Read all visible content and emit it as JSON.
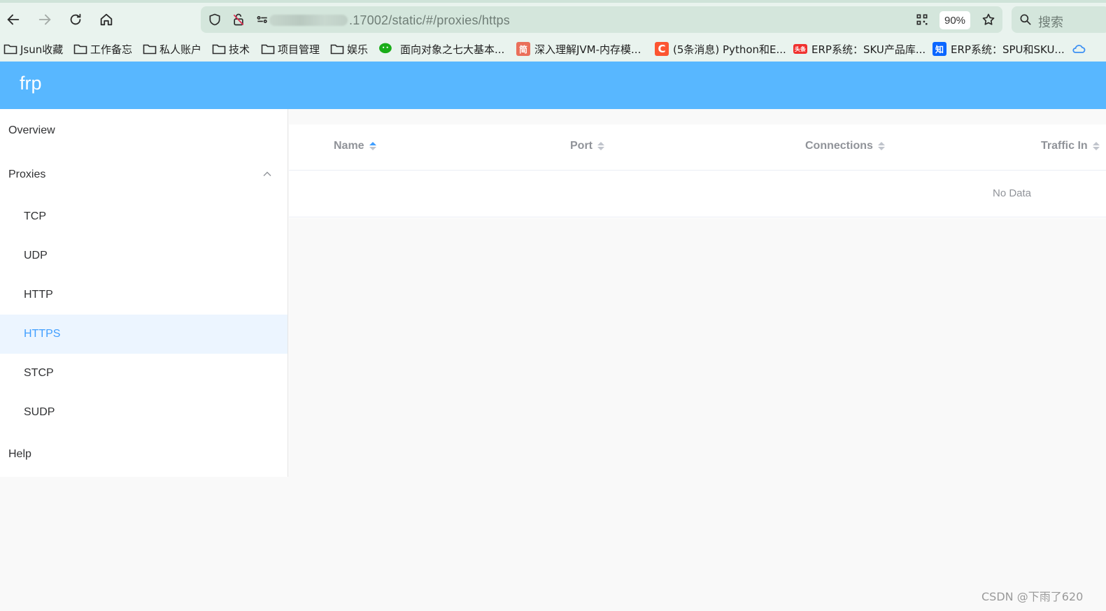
{
  "browser": {
    "url": ".17002/static/#/proxies/https",
    "zoom": "90%",
    "search_placeholder": "搜索",
    "bookmarks": [
      {
        "label": "Jsun收藏",
        "icon": "folder-icon"
      },
      {
        "label": "工作备忘",
        "icon": "folder-icon"
      },
      {
        "label": "私人账户",
        "icon": "folder-icon"
      },
      {
        "label": "技术",
        "icon": "folder-icon"
      },
      {
        "label": "项目管理",
        "icon": "folder-icon"
      },
      {
        "label": "娱乐",
        "icon": "folder-icon"
      },
      {
        "label": "面向对象之七大基本...",
        "icon": "wechat-icon"
      },
      {
        "label": "深入理解JVM-内存模...",
        "icon": "jianshu-icon",
        "badge": "简"
      },
      {
        "label": "(5条消息) Python和E...",
        "icon": "csdn-icon",
        "badge": "C"
      },
      {
        "label": "ERP系统：SKU产品库...",
        "icon": "toutiao-icon",
        "badge": "头条"
      },
      {
        "label": "ERP系统：SPU和SKU...",
        "icon": "zhihu-icon",
        "badge": "知"
      }
    ]
  },
  "app": {
    "brand": "frp",
    "colors": {
      "header": "#58b7ff",
      "accent": "#409eff",
      "active_bg": "#ecf5ff"
    },
    "sidebar": {
      "overview": "Overview",
      "proxies": "Proxies",
      "proxy_types": [
        "TCP",
        "UDP",
        "HTTP",
        "HTTPS",
        "STCP",
        "SUDP"
      ],
      "active": "HTTPS",
      "help": "Help"
    },
    "table": {
      "columns": [
        "Name",
        "Port",
        "Connections",
        "Traffic In"
      ],
      "sorted_column": "Name",
      "empty_text": "No Data"
    }
  },
  "watermark": "CSDN @下雨了620"
}
